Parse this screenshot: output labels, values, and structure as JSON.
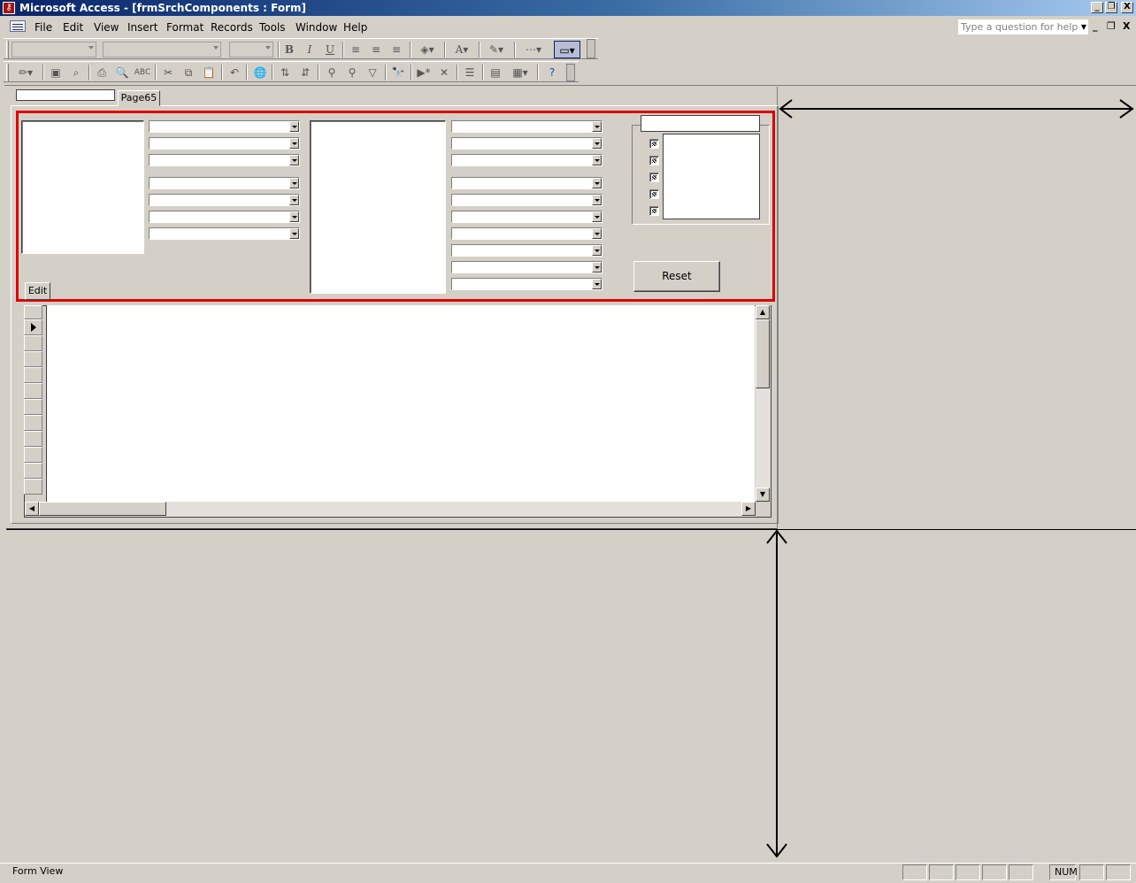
{
  "window": {
    "title": "Microsoft Access - [frmSrchComponents : Form]",
    "minimize_glyph": "_",
    "restore_glyph": "❐",
    "close_glyph": "X"
  },
  "menu": {
    "items": [
      "File",
      "Edit",
      "View",
      "Insert",
      "Format",
      "Records",
      "Tools",
      "Window",
      "Help"
    ],
    "help_placeholder": "Type a question for help"
  },
  "form": {
    "tab_label": "Page65",
    "edit_label": "Edit",
    "reset_label": "Reset"
  },
  "statusbar": {
    "text": "Form View",
    "num": "NUM"
  },
  "colors": {
    "highlight_border": "#e00000",
    "titlebar_start": "#0a246a"
  }
}
